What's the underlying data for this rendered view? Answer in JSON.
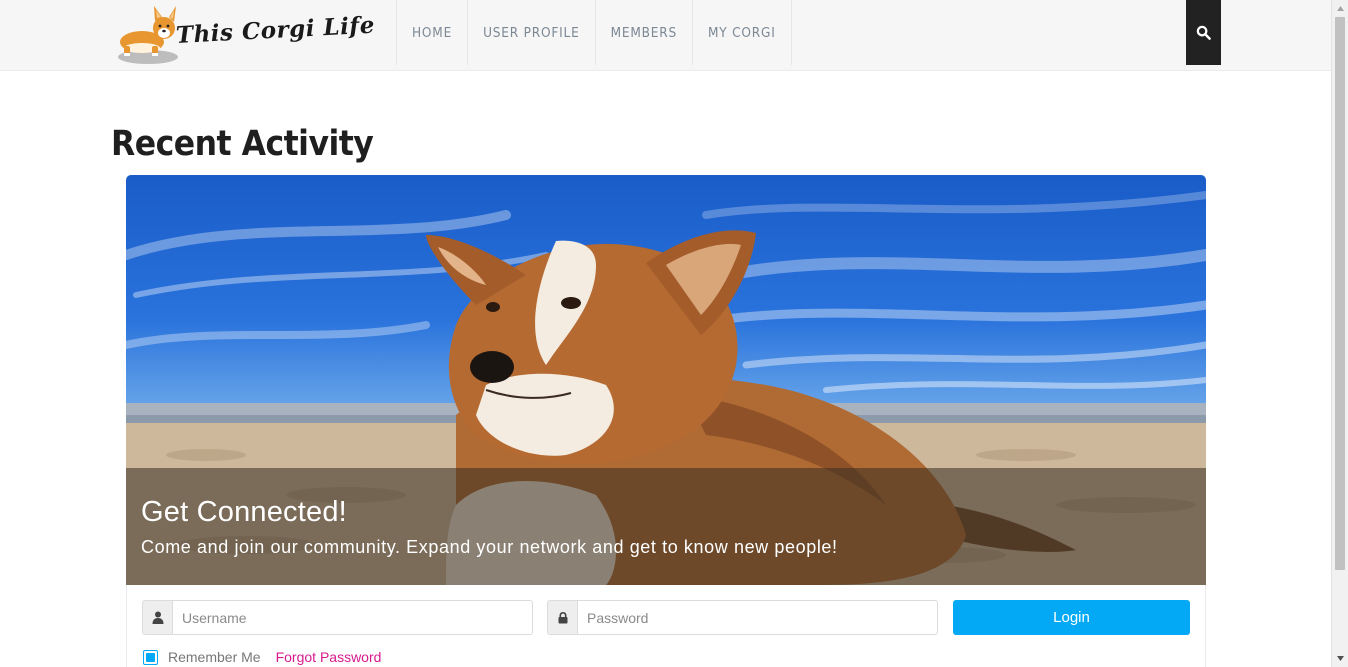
{
  "header": {
    "logo_text": "This Corgi Life",
    "nav": [
      {
        "label": "HOME"
      },
      {
        "label": "USER PROFILE"
      },
      {
        "label": "MEMBERS"
      },
      {
        "label": "MY CORGI"
      }
    ],
    "search_icon": "search-icon"
  },
  "main": {
    "title": "Recent Activity"
  },
  "hero": {
    "title": "Get Connected!",
    "subtitle": "Come and join our community. Expand your network and get to know new people!"
  },
  "login": {
    "username_placeholder": "Username",
    "username_icon": "user-icon",
    "password_placeholder": "Password",
    "password_icon": "lock-icon",
    "button_label": "Login",
    "remember_label": "Remember Me",
    "remember_checked": true,
    "forgot_label": "Forgot Password"
  },
  "colors": {
    "accent": "#03a9f4",
    "link": "#d61a8c",
    "header_bg": "#f6f6f6",
    "search_bg": "#222222"
  }
}
